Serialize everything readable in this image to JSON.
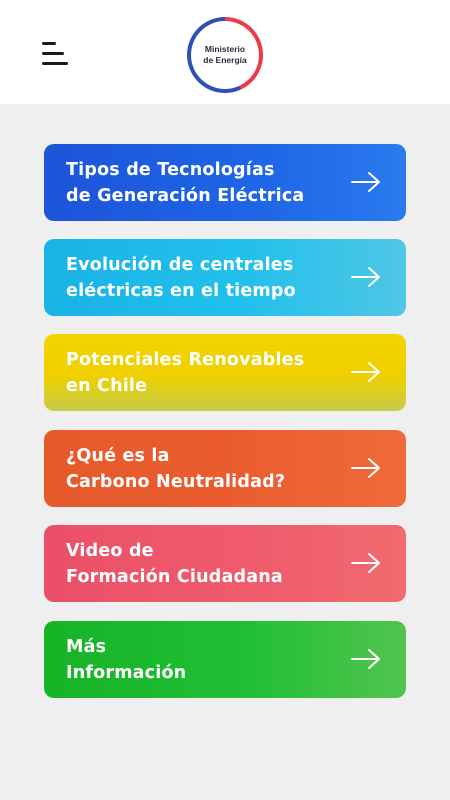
{
  "header": {
    "menu_icon": "hamburger-menu-icon",
    "logo": {
      "line1": "Ministerio",
      "line2": "de Energía",
      "colors": {
        "red": "#ed3a4a",
        "blue": "#2e4fb5"
      }
    }
  },
  "menu": {
    "items": [
      {
        "label": "Tipos de Tecnologías\nde Generación Eléctrica",
        "color": "#1f5fe0",
        "icon": "arrow-right-icon"
      },
      {
        "label": "Evolución de centrales\neléctricas en el tiempo",
        "color": "#1cb9ea",
        "icon": "arrow-right-icon"
      },
      {
        "label": "Potenciales Renovables\nen Chile",
        "color": "#f0d200",
        "icon": "arrow-right-icon"
      },
      {
        "label": "¿Qué es la\nCarbono Neutralidad?",
        "color": "#e85b2c",
        "icon": "arrow-right-icon"
      },
      {
        "label": "Video de\nFormación Ciudadana",
        "color": "#ed5569",
        "icon": "arrow-right-icon"
      },
      {
        "label": "Más\nInformación",
        "color": "#1bb92e",
        "icon": "arrow-right-icon"
      }
    ]
  }
}
